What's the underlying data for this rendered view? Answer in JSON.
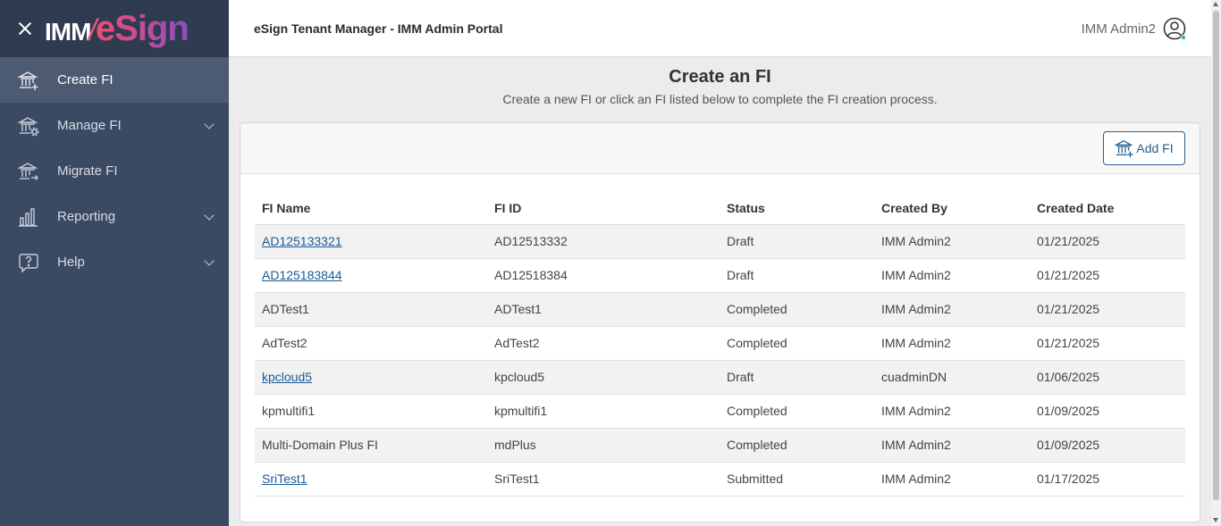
{
  "brand": {
    "logo_left": "IMM",
    "logo_slash": "/",
    "logo_right": "eSign"
  },
  "sidebar": {
    "items": [
      {
        "label": "Create FI",
        "icon": "bank-add-icon",
        "active": true,
        "expandable": false
      },
      {
        "label": "Manage FI",
        "icon": "bank-gear-icon",
        "active": false,
        "expandable": true
      },
      {
        "label": "Migrate FI",
        "icon": "bank-arrow-icon",
        "active": false,
        "expandable": false
      },
      {
        "label": "Reporting",
        "icon": "bar-chart-icon",
        "active": false,
        "expandable": true
      },
      {
        "label": "Help",
        "icon": "help-icon",
        "active": false,
        "expandable": true
      }
    ]
  },
  "header": {
    "title": "eSign Tenant Manager - IMM Admin Portal",
    "user_name": "IMM Admin2"
  },
  "main": {
    "title": "Create an FI",
    "subtitle": "Create a new FI or click an FI listed below to complete the FI creation process.",
    "add_button_label": "Add FI"
  },
  "table": {
    "columns": [
      "FI Name",
      "FI ID",
      "Status",
      "Created By",
      "Created Date"
    ],
    "rows": [
      {
        "name": "AD125133321",
        "id": "AD12513332",
        "status": "Draft",
        "created_by": "IMM Admin2",
        "date": "01/21/2025",
        "link": true
      },
      {
        "name": "AD125183844",
        "id": "AD12518384",
        "status": "Draft",
        "created_by": "IMM Admin2",
        "date": "01/21/2025",
        "link": true
      },
      {
        "name": "ADTest1",
        "id": "ADTest1",
        "status": "Completed",
        "created_by": "IMM Admin2",
        "date": "01/21/2025",
        "link": false
      },
      {
        "name": "AdTest2",
        "id": "AdTest2",
        "status": "Completed",
        "created_by": "IMM Admin2",
        "date": "01/21/2025",
        "link": false
      },
      {
        "name": "kpcloud5",
        "id": "kpcloud5",
        "status": "Draft",
        "created_by": "cuadminDN",
        "date": "01/06/2025",
        "link": true
      },
      {
        "name": "kpmultifi1",
        "id": "kpmultifi1",
        "status": "Completed",
        "created_by": "IMM Admin2",
        "date": "01/09/2025",
        "link": false
      },
      {
        "name": "Multi-Domain Plus FI",
        "id": "mdPlus",
        "status": "Completed",
        "created_by": "IMM Admin2",
        "date": "01/09/2025",
        "link": false
      },
      {
        "name": "SriTest1",
        "id": "SriTest1",
        "status": "Submitted",
        "created_by": "IMM Admin2",
        "date": "01/17/2025",
        "link": true
      }
    ]
  },
  "colors": {
    "sidebar": "#3b4a63",
    "brand_bar": "#2f3b51",
    "active_item": "#4c5a72",
    "link": "#1b5a92",
    "accent": "#2a5f8e"
  }
}
